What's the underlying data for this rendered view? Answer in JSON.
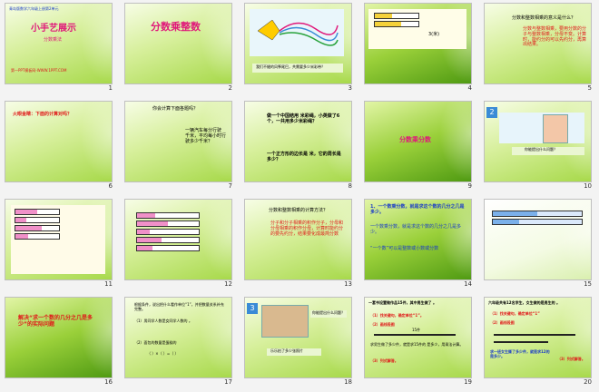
{
  "view": "slide-sorter",
  "slides": [
    {
      "n": "1",
      "lines": [
        "青岛版数学六年级上册第2单元",
        "小手艺展示",
        "分数乘法",
        "第一PPT模板网-WWW.1PPT.COM"
      ]
    },
    {
      "n": "2",
      "lines": [
        "分数乘整数"
      ]
    },
    {
      "n": "3",
      "lines": [
        "我们不缝的风筝尾巴，共需要多少米彩带？"
      ]
    },
    {
      "n": "4",
      "lines": [
        "3(米)"
      ]
    },
    {
      "n": "5",
      "lines": [
        "分数和整数相乘的意义是什么？",
        "分数与整数相乘，要用分数的分子与整数相乘，分母不变。计算时，能约分的可以先约分，再算出结果。"
      ]
    },
    {
      "n": "6",
      "lines": [
        "火眼金睛：下面的计算对吗？"
      ]
    },
    {
      "n": "7",
      "lines": [
        "你会计算下面各题吗？",
        "一辆汽车每分行驶 千米，平均每小时行驶多少千米？"
      ]
    },
    {
      "n": "8",
      "lines": [
        "做一个中国结用 米彩绳，小英做了6个，一共用多少米彩绳？",
        "一个正方形的边长是 米，它的周长是多少？"
      ]
    },
    {
      "n": "9",
      "lines": [
        "分数乘分数"
      ]
    },
    {
      "n": "10",
      "lines": [
        "你能提出什么问题？"
      ]
    },
    {
      "n": "11",
      "lines": []
    },
    {
      "n": "12",
      "lines": []
    },
    {
      "n": "13",
      "lines": [
        "分数和整数相乘的计算方法？",
        "分子和分子相乘的积作分子，分母和分母相乘的积作分母，计算时能约分的要先约分，结果要化成最简分数"
      ]
    },
    {
      "n": "14",
      "lines": [
        "1、一个数乘分数，就是求这个数的几分之几是多少。",
        "一个数乘分数，就是求这个数的几分之几是多少。",
        "“一个数”可以是整数或小数或分数"
      ]
    },
    {
      "n": "15",
      "lines": []
    },
    {
      "n": "16",
      "lines": [
        "解决“求一个数的几分之几是多少”的实际问题"
      ]
    },
    {
      "n": "17",
      "lines": [
        "根据条件，说出把什么看作单位“1”，并把数量关系补充完整。",
        "（1）男同学人数是女同学人数的 。",
        "（2）面包的数量是蛋糕的",
        "（ ）×（ ）=（ ）"
      ]
    },
    {
      "n": "18",
      "lines": [
        "你能提出什么问题？",
        "乐乐拍了多少张照片"
      ]
    },
    {
      "n": "19",
      "lines": [
        "一套书设置做作品15件，其中男生做了 。",
        "（1）找关键句，确定单位“1”。",
        "（2）画线段图",
        "15件",
        "求男生做了多少件，就是求15件的 是多少，用乘法计算。",
        "（3）列式解答。"
      ]
    },
    {
      "n": "20",
      "lines": [
        "六年级共有12名学生，女生做的是男生的 。",
        "（1）找关键句，确定单位“1”",
        "（2）画线段图",
        "求一班女生撕了多少件，就是求12的 是多少。",
        "（3）列式解答。"
      ]
    }
  ],
  "colors": {
    "accent_red": "#e01a1a",
    "accent_blue": "#1a3cc8",
    "slide_green": "#8fcf2e",
    "window_bg": "#f3f3f3"
  }
}
